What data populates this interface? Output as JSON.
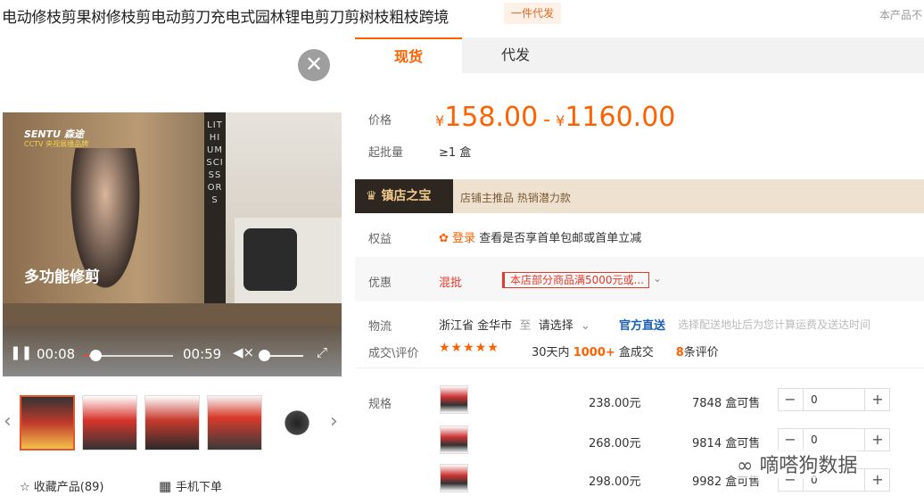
{
  "product": {
    "title": "电动修枝剪果树修枝剪电动剪刀充电式园林锂电剪刀剪树枝粗枝跨境",
    "badge": "一件代发",
    "top_right": "本产品不"
  },
  "video": {
    "brand": "SENTU 森途",
    "brand_sub": "CCTV 央视展播品牌",
    "vertical_text": "LITHIUM SCISSORS",
    "caption": "多功能修剪",
    "time_current": "00:08",
    "time_total": "00:59",
    "progress": 0.136
  },
  "actions": {
    "favorite": "收藏产品(89)",
    "mobile": "手机下单"
  },
  "tabs": [
    {
      "label": "现货",
      "active": true
    },
    {
      "label": "代发",
      "active": false
    }
  ],
  "price": {
    "label": "价格",
    "currency": "¥",
    "low": "158.00",
    "sep": "-",
    "high": "1160.00"
  },
  "moq": {
    "label": "起批量",
    "value": "≥1 盒"
  },
  "treasure": {
    "title": "镇店之宝",
    "text": "店铺主推品  热销潜力款"
  },
  "rights": {
    "label": "权益",
    "login": "登录",
    "text": "查看是否享首单包邮或首单立减"
  },
  "promo": {
    "label": "优惠",
    "mixed": "混批",
    "coupon": "本店部分商品满5000元或..."
  },
  "logistics": {
    "label": "物流",
    "from": "浙江省 金华市",
    "to_word": "至",
    "select": "请选择",
    "official": "官方直送",
    "note": "选择配送地址后为您计算运费及送达时间"
  },
  "reviews": {
    "label": "成交\\评价",
    "stars": "★★★★★",
    "deal_prefix": "30天内",
    "deal_count": "1000+",
    "deal_suffix": "盒成交",
    "review_count": "8",
    "review_suffix": "条评价"
  },
  "specs": {
    "label": "规格",
    "rows": [
      {
        "price": "238.00元",
        "stock": "7848 盒可售",
        "qty": "0"
      },
      {
        "price": "268.00元",
        "stock": "9814 盒可售",
        "qty": "0"
      },
      {
        "price": "298.00元",
        "stock": "9982 盒可售",
        "qty": "0"
      }
    ]
  },
  "watermark": "嘀嗒狗数据",
  "colors": {
    "accent": "#ff6000",
    "promo_red": "#e4392b",
    "link_blue": "#1a5fb4"
  }
}
